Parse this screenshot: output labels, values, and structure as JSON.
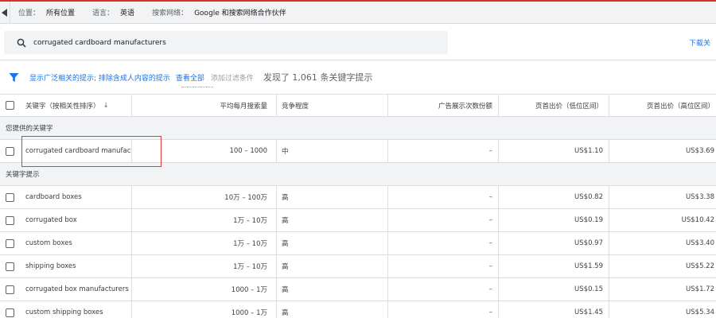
{
  "topbar": {
    "filters": [
      {
        "label": "位置：",
        "value": "所有位置"
      },
      {
        "label": "语言：",
        "value": "英语"
      },
      {
        "label": "搜索网络：",
        "value": "Google 和搜索网络合作伙伴"
      }
    ]
  },
  "search": {
    "query": "corrugated cardboard manufacturers",
    "download_label": "下载关"
  },
  "filter_bar": {
    "filter1": "显示广泛相关的提示; 排除含成人内容的提示",
    "show_all": "查看全部",
    "add_filter": "添加过滤条件",
    "result_count": "发现了 1,061 条关键字提示"
  },
  "table": {
    "columns": {
      "keyword": "关键字（按相关性排序）",
      "avg_searches": "平均每月搜索量",
      "competition": "竞争程度",
      "impression_share": "广告展示次数份额",
      "bid_low": "页首出价（低位区间）",
      "bid_high": "页首出价（高位区间）"
    },
    "sections": {
      "provided": "您提供的关键字",
      "ideas": "关键字提示"
    },
    "provided_rows": [
      {
        "keyword": "corrugated cardboard manufac...",
        "avg": "100 – 1000",
        "comp": "中",
        "share": "–",
        "low": "US$1.10",
        "high": "US$3.69"
      }
    ],
    "idea_rows": [
      {
        "keyword": "cardboard boxes",
        "avg": "10万 – 100万",
        "comp": "高",
        "share": "–",
        "low": "US$0.82",
        "high": "US$3.38"
      },
      {
        "keyword": "corrugated box",
        "avg": "1万 – 10万",
        "comp": "高",
        "share": "–",
        "low": "US$0.19",
        "high": "US$10.42"
      },
      {
        "keyword": "custom boxes",
        "avg": "1万 – 10万",
        "comp": "高",
        "share": "–",
        "low": "US$0.97",
        "high": "US$3.40"
      },
      {
        "keyword": "shipping boxes",
        "avg": "1万 – 10万",
        "comp": "高",
        "share": "–",
        "low": "US$1.59",
        "high": "US$5.22"
      },
      {
        "keyword": "corrugated box manufacturers",
        "avg": "1000 – 1万",
        "comp": "高",
        "share": "–",
        "low": "US$0.15",
        "high": "US$1.72"
      },
      {
        "keyword": "custom shipping boxes",
        "avg": "1000 – 1万",
        "comp": "高",
        "share": "–",
        "low": "US$1.45",
        "high": "US$5.34"
      }
    ]
  },
  "colors": {
    "accent": "#1a73e8",
    "highlight": "#e53935",
    "top_border": "#d93025"
  }
}
